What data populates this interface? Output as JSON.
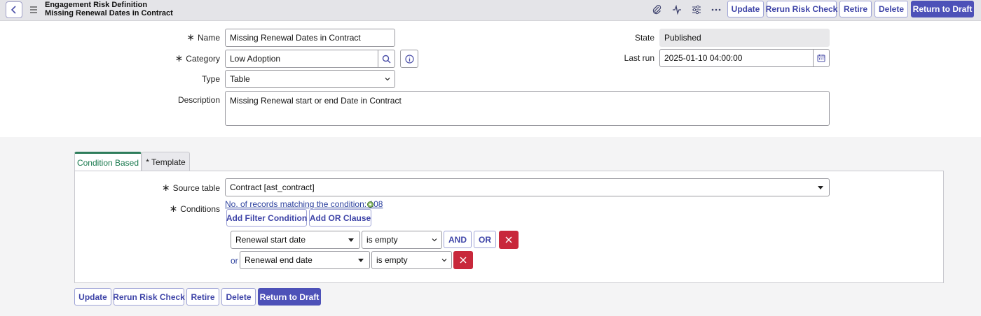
{
  "header": {
    "title": "Engagement Risk Definition",
    "subtitle": "Missing Renewal Dates in Contract",
    "icons": [
      "paperclip-icon",
      "activity-icon",
      "settings-sliders-icon",
      "more-icon"
    ],
    "buttons": {
      "update": "Update",
      "rerun": "Rerun Risk Check",
      "retire": "Retire",
      "delete": "Delete",
      "return_draft": "Return to Draft"
    }
  },
  "form": {
    "name_label": "Name",
    "name_value": "Missing Renewal Dates in Contract",
    "category_label": "Category",
    "category_value": "Low Adoption",
    "type_label": "Type",
    "type_value": "Table",
    "description_label": "Description",
    "description_value": "Missing Renewal start or end Date in Contract",
    "state_label": "State",
    "state_value": "Published",
    "last_run_label": "Last run",
    "last_run_value": "2025-01-10 04:00:00",
    "required_mark": "∗"
  },
  "tabs": {
    "condition_based": "Condition Based",
    "template": "* Template"
  },
  "conditions": {
    "source_table_label": "Source table",
    "source_table_value": "Contract [ast_contract]",
    "conditions_label": "Conditions",
    "match_link": "No. of records matching the condition: 108",
    "add_filter": "Add Filter Condition",
    "add_or": "Add OR Clause",
    "row1_field": "Renewal start date",
    "row1_op": "is empty",
    "and_label": "AND",
    "or_label": "OR",
    "or_prefix": "or",
    "row2_field": "Renewal end date",
    "row2_op": "is empty"
  },
  "footer": {
    "update": "Update",
    "rerun": "Rerun Risk Check",
    "retire": "Retire",
    "delete": "Delete",
    "return_draft": "Return to Draft"
  },
  "colors": {
    "accent": "#4d51b8",
    "active_tab": "#2e7d5b",
    "danger": "#c8283b"
  }
}
